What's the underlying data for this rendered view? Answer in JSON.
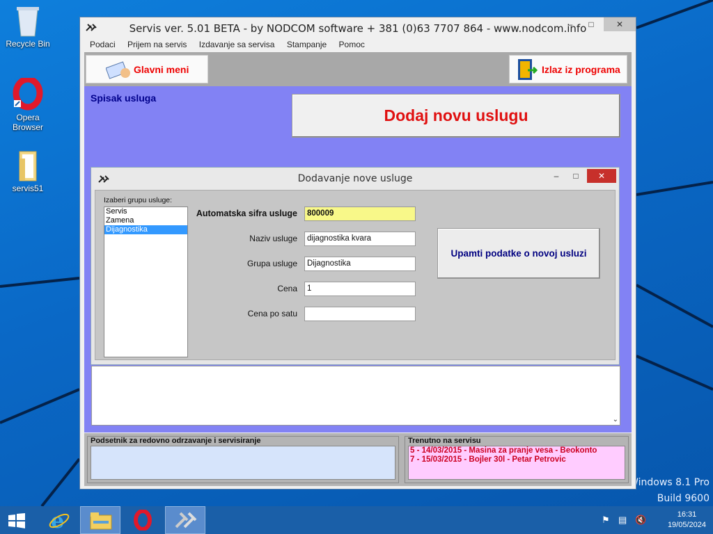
{
  "desktop": {
    "icons": [
      {
        "label": "Recycle Bin"
      },
      {
        "label": "Opera Browser"
      },
      {
        "label": "servis51"
      }
    ],
    "watermark": {
      "line1": "Windows 8.1 Pro",
      "line2": "Build 9600"
    }
  },
  "window": {
    "title": "Servis ver. 5.01 BETA - by NODCOM software  + 381 (0)63 7707 864 - www.nodcom.info",
    "menu": [
      "Podaci",
      "Prijem na servis",
      "Izdavanje sa servisa",
      "Stampanje",
      "Pomoc"
    ],
    "toolbar": {
      "main_menu": "Glavni meni",
      "exit": "Izlaz iz programa"
    },
    "section_label": "Spisak usluga",
    "add_button": "Dodaj novu uslugu",
    "bottom": {
      "reminder_title": "Podsetnik za redovno odrzavanje i servisiranje",
      "current_title": "Trenutno na servisu",
      "current_items": [
        "5 - 14/03/2015 - Masina za pranje vesa - Beokonto",
        "7 - 15/03/2015 - Bojler 30l - Petar Petrovic"
      ]
    }
  },
  "dialog": {
    "title": "Dodavanje nove usluge",
    "group_label": "Izaberi grupu usluge:",
    "groups": [
      "Servis",
      "Zamena",
      "Dijagnostika"
    ],
    "selected_group": "Dijagnostika",
    "fields": {
      "code_label": "Automatska sifra usluge",
      "code_value": "800009",
      "name_label": "Naziv usluge",
      "name_value": "dijagnostika kvara",
      "group_label": "Grupa usluge",
      "group_value": "Dijagnostika",
      "price_label": "Cena",
      "price_value": "1",
      "hourly_label": "Cena po satu",
      "hourly_value": ""
    },
    "save_button": "Upamti podatke o novoj usluzi"
  },
  "taskbar": {
    "clock_time": "16:31",
    "clock_date": "19/05/2024"
  },
  "colors": {
    "main_area": "#8282f4",
    "accent_red": "#e01010",
    "navy": "#000080",
    "yellow_field": "#f8f889",
    "reminder_bg": "#d6e4fb",
    "current_bg": "#ffccff"
  }
}
